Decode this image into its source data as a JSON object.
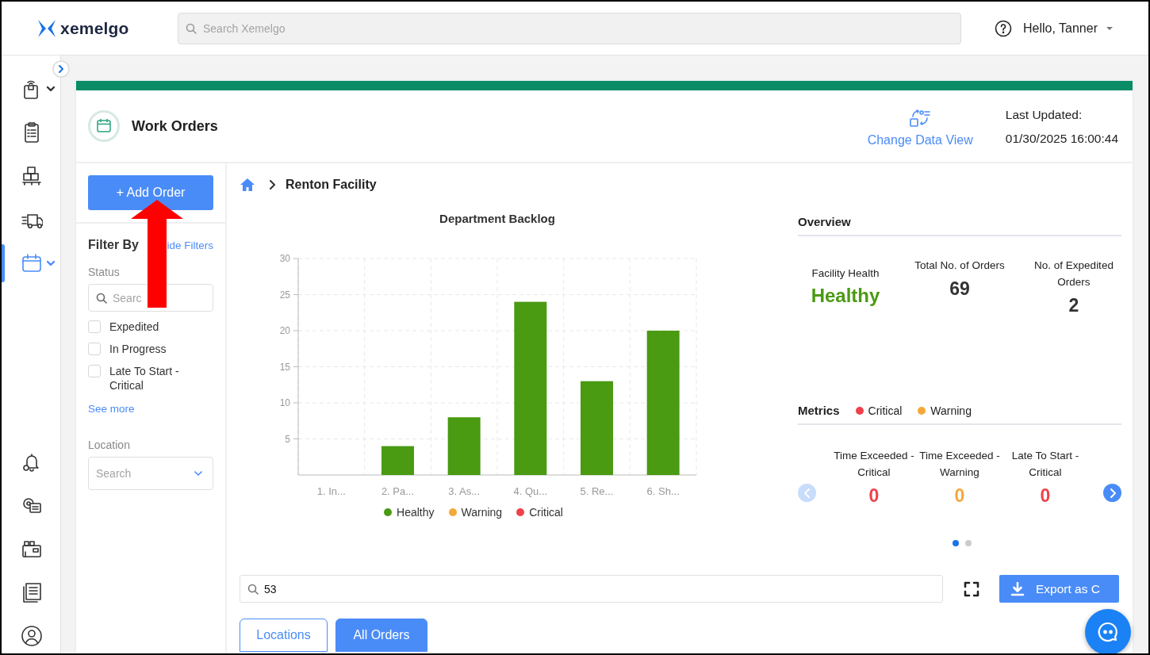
{
  "header": {
    "logo": "xemelgo",
    "search": {
      "placeholder": "Search Xemelgo"
    },
    "user": "Hello, Tanner"
  },
  "sidebar": {
    "items": [
      {
        "selected": false,
        "expandable": true
      },
      {
        "selected": false,
        "expandable": false
      },
      {
        "selected": false,
        "expandable": false
      },
      {
        "selected": false,
        "expandable": false
      },
      {
        "selected": true,
        "expandable": true
      }
    ]
  },
  "page": {
    "title": "Work Orders",
    "change_view": "Change Data View",
    "last_updated_label": "Last Updated:",
    "last_updated": "01/30/2025 16:00:44"
  },
  "filters": {
    "add_button": "+ Add Order",
    "heading": "Filter By",
    "hide_link": "ide Filters",
    "status_label": "Status",
    "status_search": {
      "placeholder": "Searc"
    },
    "options": [
      {
        "label": "Expedited",
        "checked": false
      },
      {
        "label": "In Progress",
        "checked": false
      },
      {
        "label": "Late To Start - Critical",
        "checked": false
      }
    ],
    "see_more": "See more",
    "location_label": "Location",
    "location_select": {
      "placeholder": "Search"
    }
  },
  "breadcrumb": [
    "Renton Facility"
  ],
  "backlog": {
    "chart_data": {
      "type": "bar",
      "title": "Department Backlog",
      "categories": [
        "1. In...",
        "2. Pa...",
        "3. As...",
        "4. Qu...",
        "5. Re...",
        "6. Sh..."
      ],
      "series": [
        {
          "name": "Healthy",
          "color": "#4a9a12",
          "values": [
            0,
            4,
            8,
            24,
            13,
            20
          ]
        },
        {
          "name": "Warning",
          "color": "#f5a83a",
          "values": [
            0,
            0,
            0,
            0,
            0,
            0
          ]
        },
        {
          "name": "Critical",
          "color": "#f0414b",
          "values": [
            0,
            0,
            0,
            0,
            0,
            0
          ]
        }
      ],
      "ylim": [
        0,
        30
      ],
      "yticks": [
        5,
        10,
        15,
        20,
        25,
        30
      ],
      "stacked": true,
      "grid": true
    }
  },
  "overview": {
    "title": "Overview",
    "stats": [
      {
        "label": "Facility Health",
        "value": "Healthy",
        "color": "#4a9a12"
      },
      {
        "label": "Total No. of Orders",
        "value": "69",
        "color": "#333333"
      },
      {
        "label": "No. of Expedited Orders",
        "value": "2",
        "color": "#333333"
      }
    ]
  },
  "metrics": {
    "title": "Metrics",
    "legend": [
      {
        "label": "Critical",
        "color": "#f0414b"
      },
      {
        "label": "Warning",
        "color": "#f5a83a"
      }
    ],
    "prev_disabled": true,
    "next_disabled": false,
    "items": [
      {
        "label": "Time Exceeded - Critical",
        "value": "0",
        "color": "#f0414b"
      },
      {
        "label": "Time Exceeded - Warning",
        "value": "0",
        "color": "#f5a83a"
      },
      {
        "label": "Late To Start - Critical",
        "value": "0",
        "color": "#f0414b"
      }
    ],
    "pages": [
      {
        "selected": true
      },
      {
        "selected": false
      }
    ]
  },
  "table_search": {
    "value": "53"
  },
  "export_button": "Export as C",
  "tabs": [
    {
      "label": "Locations",
      "selected": false
    },
    {
      "label": "All Orders",
      "selected": true
    }
  ]
}
